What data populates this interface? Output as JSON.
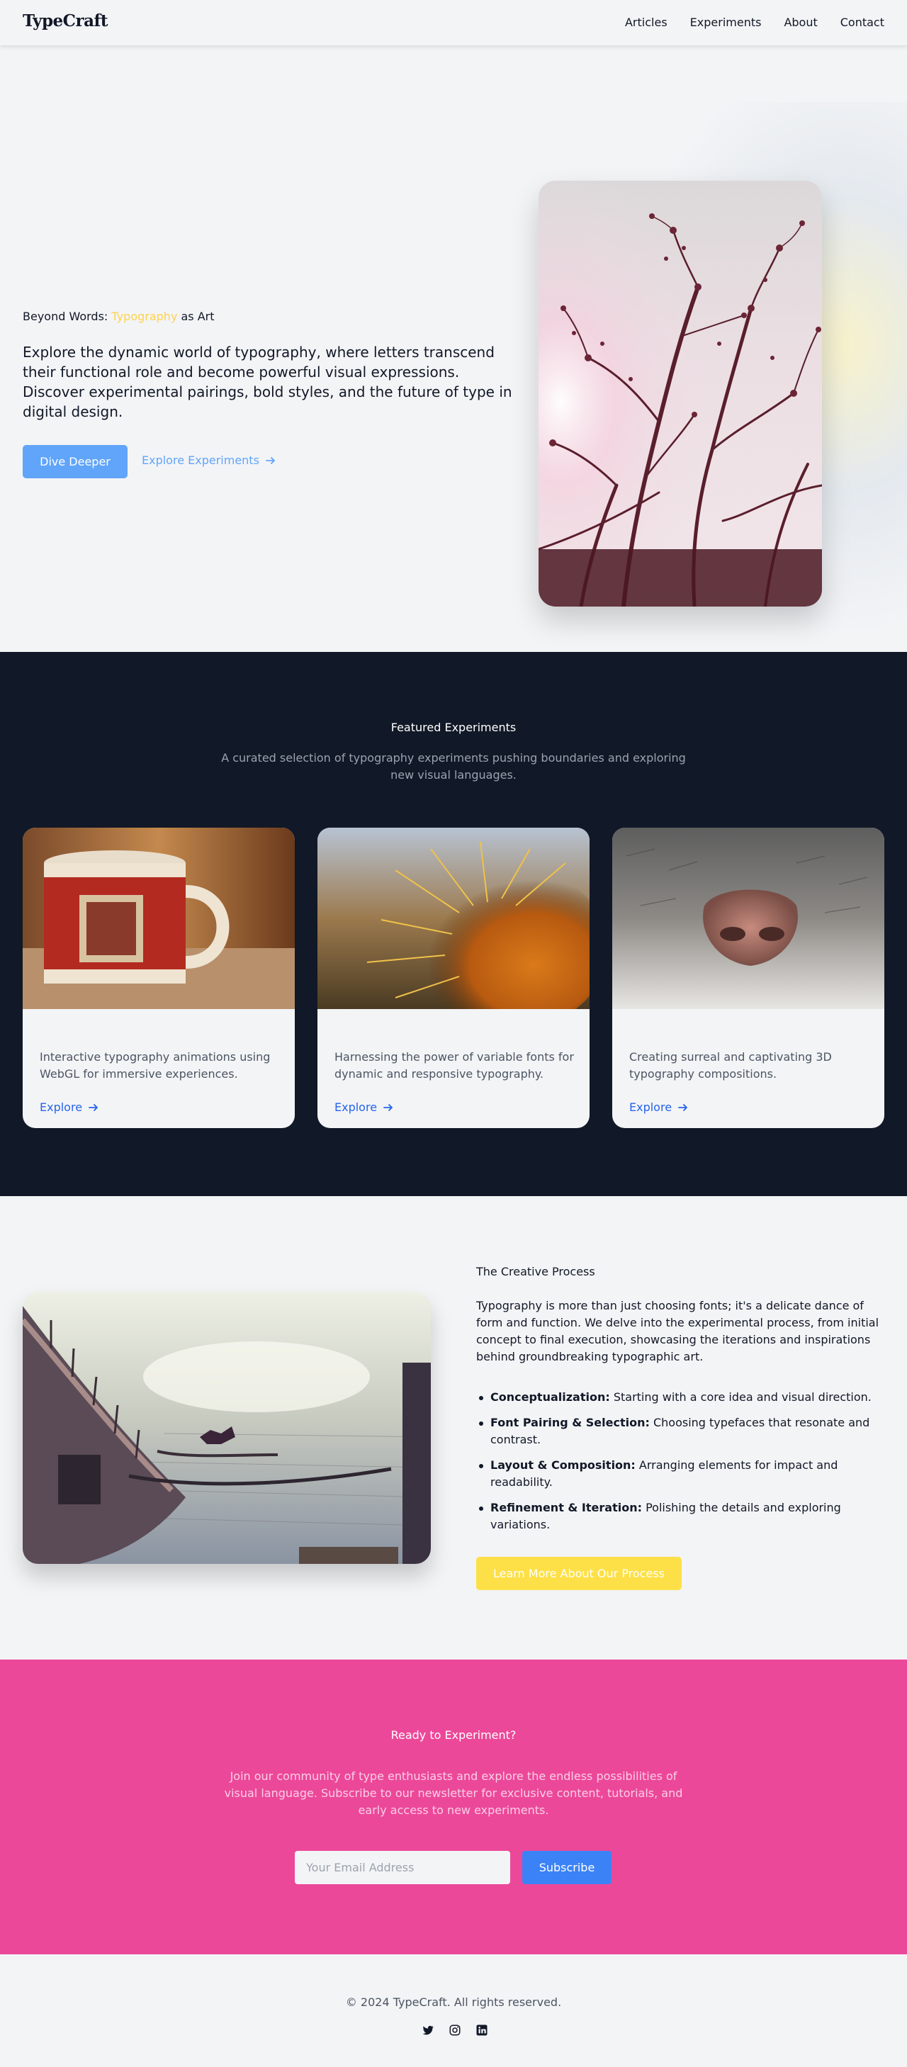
{
  "header": {
    "logo": "TypeCraft",
    "nav": [
      "Articles",
      "Experiments",
      "About",
      "Contact"
    ]
  },
  "hero": {
    "subtitle_prefix": "Beyond Words: ",
    "subtitle_accent": "Typography",
    "subtitle_suffix": " as Art",
    "description": "Explore the dynamic world of typography, where letters transcend their functional role and become powerful visual expressions. Discover experimental pairings, bold styles, and the future of type in digital design.",
    "primary_button": "Dive Deeper",
    "secondary_link": "Explore Experiments"
  },
  "featured": {
    "title": "Featured Experiments",
    "subtitle": "A curated selection of typography experiments pushing boundaries and exploring new visual languages.",
    "cards": [
      {
        "text": "Interactive typography animations using WebGL for immersive experiences.",
        "link": "Explore"
      },
      {
        "text": "Harnessing the power of variable fonts for dynamic and responsive typography.",
        "link": "Explore"
      },
      {
        "text": "Creating surreal and captivating 3D typography compositions.",
        "link": "Explore"
      }
    ]
  },
  "process": {
    "title": "The Creative Process",
    "description": "Typography is more than just choosing fonts; it's a delicate dance of form and function. We delve into the experimental process, from initial concept to final execution, showcasing the iterations and inspirations behind groundbreaking typographic art.",
    "steps": [
      {
        "label": "Conceptualization:",
        "text": " Starting with a core idea and visual direction."
      },
      {
        "label": "Font Pairing & Selection:",
        "text": " Choosing typefaces that resonate and contrast."
      },
      {
        "label": "Layout & Composition:",
        "text": " Arranging elements for impact and readability."
      },
      {
        "label": "Refinement & Iteration:",
        "text": " Polishing the details and exploring variations."
      }
    ],
    "button": "Learn More About Our Process"
  },
  "cta": {
    "title": "Ready to Experiment?",
    "description": "Join our community of type enthusiasts and explore the endless possibilities of visual language. Subscribe to our newsletter for exclusive content, tutorials, and early access to new experiments.",
    "email_placeholder": "Your Email Address",
    "button": "Subscribe"
  },
  "footer": {
    "copyright": "© 2024 TypeCraft. All rights reserved.",
    "socials": [
      "twitter-icon",
      "instagram-icon",
      "linkedin-icon"
    ]
  },
  "colors": {
    "accent_yellow": "#fcd34d",
    "accent_blue": "#60a5fa",
    "dark_section": "#111827",
    "cta_pink": "#ec4899",
    "subscribe_blue": "#3b82f6"
  }
}
